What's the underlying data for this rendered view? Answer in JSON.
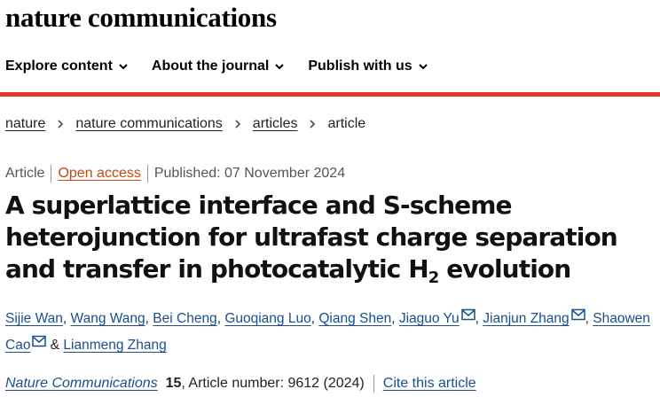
{
  "site": {
    "title": "nature communications"
  },
  "nav": [
    {
      "label": "Explore content"
    },
    {
      "label": "About the journal"
    },
    {
      "label": "Publish with us"
    }
  ],
  "breadcrumb": [
    "nature",
    "nature communications",
    "articles",
    "article"
  ],
  "meta": {
    "type": "Article",
    "access": "Open access",
    "published": "Published: 07 November 2024"
  },
  "article": {
    "title_part1": "A superlattice interface and S-scheme heterojunction for ultrafast charge separation and transfer in photocatalytic H",
    "title_sub": "2",
    "title_part2": " evolution"
  },
  "authors": [
    {
      "name": "Sijie Wan",
      "corresponding": false
    },
    {
      "name": "Wang Wang",
      "corresponding": false
    },
    {
      "name": "Bei Cheng",
      "corresponding": false
    },
    {
      "name": "Guoqiang Luo",
      "corresponding": false
    },
    {
      "name": "Qiang Shen",
      "corresponding": false
    },
    {
      "name": "Jiaguo Yu",
      "corresponding": true
    },
    {
      "name": "Jianjun Zhang",
      "corresponding": true
    },
    {
      "name": "Shaowen Cao",
      "corresponding": true
    },
    {
      "name": "Lianmeng Zhang",
      "corresponding": false
    }
  ],
  "citation": {
    "journal": "Nature Communications",
    "volume": "15",
    "article_number": ", Article number: 9612 (2024)",
    "cite_link": "Cite this article"
  },
  "colors": {
    "accent_red": "#e8352a",
    "link_blue": "#1a4f8b",
    "open_access_orange": "#c8470d"
  },
  "icons": {
    "dropdown": "chevron-down-icon",
    "breadcrumb": "chevron-right-icon",
    "email": "envelope-icon"
  }
}
